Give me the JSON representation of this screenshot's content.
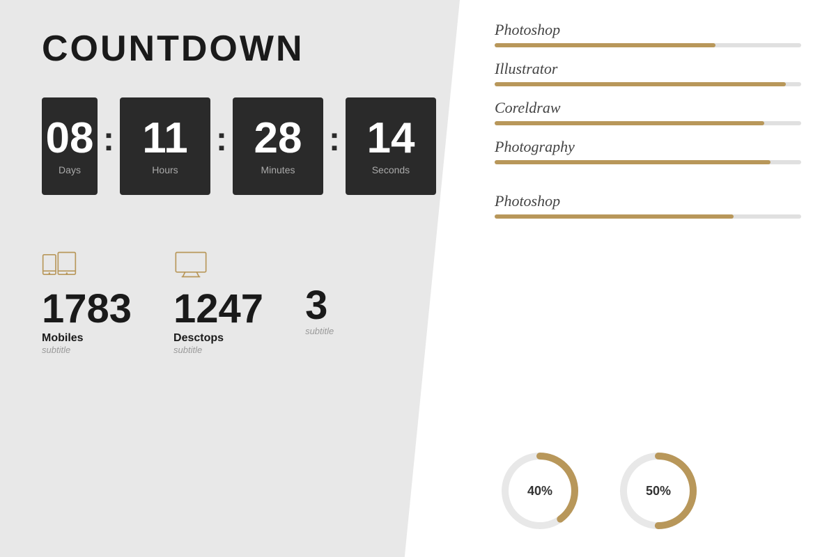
{
  "left": {
    "title": "COUNTDOWN",
    "timer": {
      "days": {
        "value": "08",
        "label": "Days",
        "partial": true
      },
      "hours": {
        "value": "11",
        "label": "Hours"
      },
      "minutes": {
        "value": "28",
        "label": "Minutes"
      },
      "seconds": {
        "value": "14",
        "label": "Seconds"
      }
    },
    "stats": [
      {
        "id": "mobiles",
        "number": "1783",
        "label": "Mobiles",
        "sublabel": "subtitle",
        "icon": "mobile"
      },
      {
        "id": "desktops",
        "number": "1247",
        "label": "Desctops",
        "sublabel": "subtitle",
        "icon": "desktop"
      },
      {
        "id": "partial",
        "number": "3",
        "label": "...",
        "sublabel": "subtitle",
        "icon": "desktop",
        "partial": true
      }
    ]
  },
  "right": {
    "skills": [
      {
        "name": "Photoshop",
        "percent": 72
      },
      {
        "name": "Illustrator",
        "percent": 95
      },
      {
        "name": "Coreldraw",
        "percent": 88
      },
      {
        "name": "Photography",
        "percent": 90
      }
    ],
    "skills2": [
      {
        "name": "Photoshop",
        "percent": 78
      }
    ],
    "donuts": [
      {
        "label": "40%",
        "percent": 40
      },
      {
        "label": "50%",
        "percent": 50
      }
    ]
  },
  "colors": {
    "accent": "#b8975a",
    "dark": "#2a2a2a",
    "bg_left": "#e8e8e8",
    "track": "#e0e0e0"
  }
}
